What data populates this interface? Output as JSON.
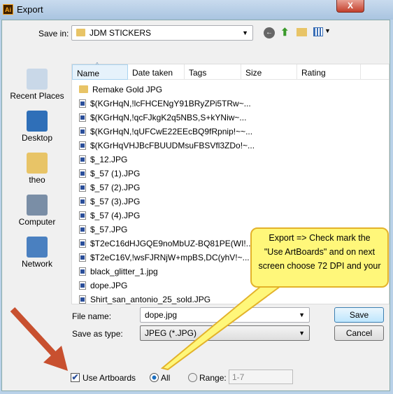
{
  "window": {
    "title": "Export",
    "close": "X"
  },
  "save_in": {
    "label": "Save in:",
    "value": "JDM STICKERS"
  },
  "toolbar": [
    "back-icon",
    "up-folder-icon",
    "new-folder-icon",
    "view-menu-icon"
  ],
  "places": [
    {
      "label": "Recent Places",
      "icon": "recent-places-icon"
    },
    {
      "label": "Desktop",
      "icon": "desktop-icon"
    },
    {
      "label": "theo",
      "icon": "user-folder-icon"
    },
    {
      "label": "Computer",
      "icon": "computer-icon"
    },
    {
      "label": "Network",
      "icon": "network-icon"
    }
  ],
  "columns": [
    "Name",
    "Date taken",
    "Tags",
    "Size",
    "Rating"
  ],
  "files": [
    {
      "name": "Remake Gold JPG",
      "type": "folder"
    },
    {
      "name": "$(KGrHqN,!lcFHCENgY91BRyZPi5TRw~...",
      "type": "image"
    },
    {
      "name": "$(KGrHqN,!qcFJkgK2q5NBS,S+kYNiw~...",
      "type": "image"
    },
    {
      "name": "$(KGrHqN,!qUFCwE22EEcBQ9fRpnip!~~...",
      "type": "image"
    },
    {
      "name": "$(KGrHqVHJBcFBUUDMsuFBSVfl3ZDo!~...",
      "type": "image"
    },
    {
      "name": "$_12.JPG",
      "type": "image"
    },
    {
      "name": "$_57 (1).JPG",
      "type": "image"
    },
    {
      "name": "$_57 (2).JPG",
      "type": "image"
    },
    {
      "name": "$_57 (3).JPG",
      "type": "image"
    },
    {
      "name": "$_57 (4).JPG",
      "type": "image"
    },
    {
      "name": "$_57.JPG",
      "type": "image"
    },
    {
      "name": "$T2eC16dHJGQE9noMbUZ-BQ81PE(WI!...",
      "type": "image"
    },
    {
      "name": "$T2eC16V,!wsFJRNjW+mpBS,DC(yhV!~...",
      "type": "image"
    },
    {
      "name": "black_glitter_1.jpg",
      "type": "image"
    },
    {
      "name": "dope.JPG",
      "type": "image"
    },
    {
      "name": "Shirt_san_antonio_25_sold.JPG",
      "type": "image"
    }
  ],
  "file_name": {
    "label": "File name:",
    "value": "dope.jpg"
  },
  "save_type": {
    "label": "Save as type:",
    "value": "JPEG (*.JPG)"
  },
  "buttons": {
    "save": "Save",
    "cancel": "Cancel"
  },
  "options": {
    "use_artboards": "Use Artboards",
    "use_artboards_checked": true,
    "all": "All",
    "all_selected": true,
    "range": "Range:",
    "range_value": "1-7"
  },
  "callout": {
    "line1": "Export => Check mark the",
    "line2": "\"Use ArtBoards\" and on next",
    "line3": "screen choose 72 DPI and your"
  },
  "colors": {
    "arrow": "#c8502f",
    "callout_fill": "#fff77a",
    "callout_border": "#e3b22a"
  }
}
